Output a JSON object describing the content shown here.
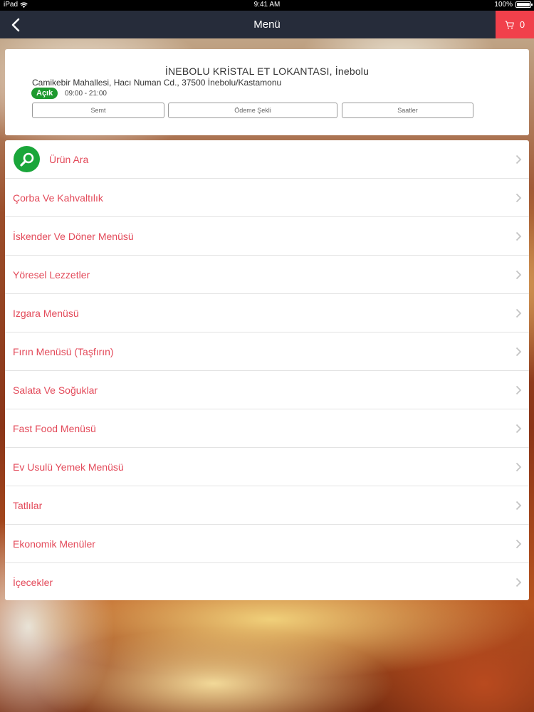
{
  "status_bar": {
    "device": "iPad",
    "time": "9:41 AM",
    "battery": "100%"
  },
  "nav": {
    "title": "Menü",
    "cart_count": "0"
  },
  "restaurant": {
    "name": "İNEBOLU KRİSTAL ET LOKANTASI, İnebolu",
    "address": "Camikebir Mahallesi, Hacı Numan Cd., 37500 İnebolu/Kastamonu",
    "status": "Açık",
    "hours": "09:00 - 21:00",
    "buttons": {
      "semt": "Semt",
      "odeme": "Ödeme Şekli",
      "saatler": "Saatler"
    }
  },
  "search_item": {
    "label": "Ürün Ara"
  },
  "categories": [
    {
      "label": "Çorba Ve Kahvaltılık"
    },
    {
      "label": "İskender Ve Döner Menüsü"
    },
    {
      "label": "Yöresel Lezzetler"
    },
    {
      "label": "Izgara Menüsü"
    },
    {
      "label": "Fırın Menüsü (Taşfırın)"
    },
    {
      "label": "Salata Ve Soğuklar"
    },
    {
      "label": "Fast Food Menüsü"
    },
    {
      "label": "Ev Usulü Yemek Menüsü"
    },
    {
      "label": "Tatlılar"
    },
    {
      "label": "Ekonomik Menüler"
    },
    {
      "label": "İçecekler"
    }
  ],
  "colors": {
    "nav_bg": "#262c3a",
    "cart_bg": "#f1404b",
    "accent_text": "#e34a5a",
    "open_badge": "#1e9a2f",
    "search_circle": "#1aa63a"
  }
}
